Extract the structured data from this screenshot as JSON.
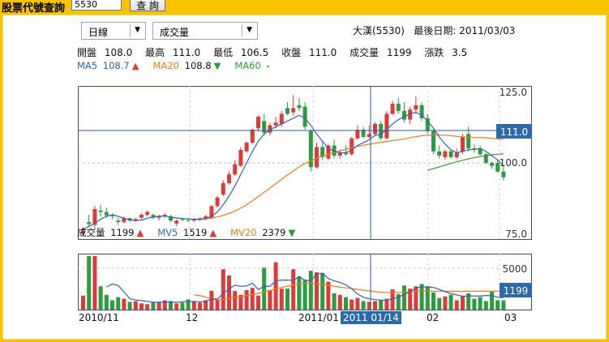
{
  "query": {
    "label": "股票代號查詢",
    "input_value": "5530",
    "button_label": "查 詢"
  },
  "selectors": {
    "period": "日線",
    "indicator": "成交量"
  },
  "stock": {
    "name_code": "大漢(5530)",
    "last_date_label": "最後日期:",
    "last_date": "2011/03/03"
  },
  "ohlc": {
    "open_label": "開盤",
    "open": "108.0",
    "high_label": "最高",
    "high": "111.0",
    "low_label": "最低",
    "low": "106.5",
    "close_label": "收盤",
    "close": "111.0",
    "volume_label": "成交量",
    "volume": "1199",
    "change_label": "漲跌",
    "change": "3.5"
  },
  "ma": {
    "ma5_label": "MA5",
    "ma5_value": "108.7",
    "ma5_arrow": "▲",
    "ma20_label": "MA20",
    "ma20_value": "108.8",
    "ma20_arrow": "▼",
    "ma60_label": "MA60",
    "ma60_value": "-"
  },
  "volume_info": {
    "label": "成交量",
    "value": "1199",
    "arrow": "▲",
    "mv5_label": "MV5",
    "mv5_value": "1519",
    "mv5_arrow": "▲",
    "mv20_label": "MV20",
    "mv20_value": "2379",
    "mv20_arrow": "▼"
  },
  "price_axis": {
    "top": "125.0",
    "mid": "100.0",
    "bottom": "75.0",
    "cursor": "111.0"
  },
  "volume_axis": {
    "top": "5000",
    "cursor": "1199"
  },
  "xaxis": {
    "labels": [
      "2010/11",
      "12",
      "2011/01",
      "02",
      "03"
    ],
    "cursor_date": "2011 01/14"
  },
  "colors": {
    "up": "#dd3b3b",
    "down": "#2f9a3f",
    "ma5": "#2d63b8",
    "ma20": "#f07a1c",
    "ma60": "#3a9a3a",
    "cursor_badge": "#2d6aa9",
    "page_bg": "#f8c400"
  },
  "chart_data": [
    {
      "type": "candlestick",
      "title": "",
      "y_range": [
        75,
        125
      ],
      "candles": [
        {
          "o": 75.5,
          "h": 77.5,
          "l": 74.8,
          "c": 76.5
        },
        {
          "o": 79.5,
          "h": 82.0,
          "l": 78.0,
          "c": 78.8
        },
        {
          "o": 78.5,
          "h": 85.0,
          "l": 77.0,
          "c": 84.0
        },
        {
          "o": 83.5,
          "h": 85.5,
          "l": 81.5,
          "c": 83.0
        },
        {
          "o": 83.0,
          "h": 84.5,
          "l": 81.0,
          "c": 81.8
        },
        {
          "o": 81.8,
          "h": 82.5,
          "l": 80.5,
          "c": 81.5
        },
        {
          "o": 80.0,
          "h": 81.0,
          "l": 78.5,
          "c": 79.5
        },
        {
          "o": 79.5,
          "h": 81.5,
          "l": 79.0,
          "c": 80.8
        },
        {
          "o": 80.8,
          "h": 81.0,
          "l": 79.5,
          "c": 80.0
        },
        {
          "o": 80.0,
          "h": 81.0,
          "l": 79.5,
          "c": 80.5
        },
        {
          "o": 81.0,
          "h": 82.5,
          "l": 80.5,
          "c": 82.0
        },
        {
          "o": 82.0,
          "h": 83.5,
          "l": 81.5,
          "c": 83.0
        },
        {
          "o": 82.0,
          "h": 82.5,
          "l": 80.5,
          "c": 81.0
        },
        {
          "o": 81.0,
          "h": 82.0,
          "l": 80.0,
          "c": 81.5
        },
        {
          "o": 81.5,
          "h": 82.5,
          "l": 80.8,
          "c": 82.0
        },
        {
          "o": 81.5,
          "h": 82.0,
          "l": 79.5,
          "c": 80.0
        },
        {
          "o": 79.0,
          "h": 80.5,
          "l": 78.0,
          "c": 80.0
        },
        {
          "o": 80.5,
          "h": 81.0,
          "l": 79.8,
          "c": 80.2
        },
        {
          "o": 80.2,
          "h": 80.8,
          "l": 79.5,
          "c": 80.0
        },
        {
          "o": 80.0,
          "h": 81.0,
          "l": 79.5,
          "c": 80.5
        },
        {
          "o": 80.3,
          "h": 81.2,
          "l": 79.8,
          "c": 80.8
        },
        {
          "o": 80.8,
          "h": 82.0,
          "l": 80.0,
          "c": 81.5
        },
        {
          "o": 81.0,
          "h": 85.5,
          "l": 80.5,
          "c": 85.0
        },
        {
          "o": 85.0,
          "h": 88.5,
          "l": 84.5,
          "c": 88.0
        },
        {
          "o": 89.0,
          "h": 94.0,
          "l": 88.5,
          "c": 93.0
        },
        {
          "o": 93.0,
          "h": 97.0,
          "l": 92.5,
          "c": 96.0
        },
        {
          "o": 96.0,
          "h": 101.0,
          "l": 95.5,
          "c": 99.5
        },
        {
          "o": 99.0,
          "h": 105.5,
          "l": 98.5,
          "c": 104.5
        },
        {
          "o": 104.0,
          "h": 107.5,
          "l": 103.5,
          "c": 107.0
        },
        {
          "o": 107.0,
          "h": 112.0,
          "l": 106.5,
          "c": 111.5
        },
        {
          "o": 112.0,
          "h": 116.5,
          "l": 111.0,
          "c": 116.0
        },
        {
          "o": 114.5,
          "h": 117.0,
          "l": 109.5,
          "c": 110.5
        },
        {
          "o": 110.5,
          "h": 114.0,
          "l": 109.5,
          "c": 113.0
        },
        {
          "o": 113.0,
          "h": 116.0,
          "l": 112.0,
          "c": 114.0
        },
        {
          "o": 113.5,
          "h": 118.0,
          "l": 112.5,
          "c": 117.0
        },
        {
          "o": 119.0,
          "h": 121.0,
          "l": 116.5,
          "c": 117.0
        },
        {
          "o": 117.5,
          "h": 123.5,
          "l": 116.5,
          "c": 119.0
        },
        {
          "o": 120.0,
          "h": 122.5,
          "l": 118.0,
          "c": 119.0
        },
        {
          "o": 119.5,
          "h": 121.0,
          "l": 111.5,
          "c": 112.5
        },
        {
          "o": 111.0,
          "h": 111.5,
          "l": 97.0,
          "c": 98.5
        },
        {
          "o": 98.5,
          "h": 107.0,
          "l": 98.0,
          "c": 105.5
        },
        {
          "o": 105.5,
          "h": 107.5,
          "l": 101.0,
          "c": 102.0
        },
        {
          "o": 101.5,
          "h": 106.5,
          "l": 101.0,
          "c": 106.0
        },
        {
          "o": 106.0,
          "h": 108.0,
          "l": 101.5,
          "c": 102.5
        },
        {
          "o": 102.5,
          "h": 104.5,
          "l": 101.5,
          "c": 103.5
        },
        {
          "o": 103.5,
          "h": 106.0,
          "l": 102.5,
          "c": 103.0
        },
        {
          "o": 103.0,
          "h": 109.0,
          "l": 102.5,
          "c": 108.5
        },
        {
          "o": 108.5,
          "h": 113.0,
          "l": 108.0,
          "c": 111.5
        },
        {
          "o": 111.5,
          "h": 112.5,
          "l": 108.5,
          "c": 109.0
        },
        {
          "o": 109.0,
          "h": 113.0,
          "l": 108.5,
          "c": 110.0
        },
        {
          "o": 110.0,
          "h": 114.0,
          "l": 109.5,
          "c": 113.5
        },
        {
          "o": 113.5,
          "h": 114.5,
          "l": 108.0,
          "c": 108.5
        },
        {
          "o": 108.5,
          "h": 118.0,
          "l": 108.0,
          "c": 117.0
        },
        {
          "o": 117.0,
          "h": 121.5,
          "l": 116.5,
          "c": 120.5
        },
        {
          "o": 120.5,
          "h": 122.5,
          "l": 117.0,
          "c": 118.0
        },
        {
          "o": 118.0,
          "h": 121.0,
          "l": 114.0,
          "c": 115.0
        },
        {
          "o": 115.0,
          "h": 119.5,
          "l": 113.5,
          "c": 118.5
        },
        {
          "o": 118.5,
          "h": 123.0,
          "l": 117.0,
          "c": 120.0
        },
        {
          "o": 120.0,
          "h": 121.0,
          "l": 114.5,
          "c": 115.5
        },
        {
          "o": 115.5,
          "h": 117.0,
          "l": 110.0,
          "c": 111.0
        },
        {
          "o": 111.0,
          "h": 111.5,
          "l": 103.0,
          "c": 104.0
        },
        {
          "o": 104.0,
          "h": 106.0,
          "l": 101.5,
          "c": 102.5
        },
        {
          "o": 102.0,
          "h": 104.5,
          "l": 101.0,
          "c": 104.0
        },
        {
          "o": 104.0,
          "h": 104.5,
          "l": 101.5,
          "c": 102.0
        },
        {
          "o": 102.0,
          "h": 105.0,
          "l": 101.5,
          "c": 103.5
        },
        {
          "o": 104.0,
          "h": 110.0,
          "l": 103.0,
          "c": 109.0
        },
        {
          "o": 110.0,
          "h": 112.5,
          "l": 104.0,
          "c": 105.0
        },
        {
          "o": 105.0,
          "h": 106.5,
          "l": 103.5,
          "c": 104.5
        },
        {
          "o": 105.0,
          "h": 106.0,
          "l": 102.5,
          "c": 103.0
        },
        {
          "o": 103.0,
          "h": 103.5,
          "l": 99.5,
          "c": 100.0
        },
        {
          "o": 100.0,
          "h": 100.5,
          "l": 98.0,
          "c": 99.0
        },
        {
          "o": 100.0,
          "h": 101.0,
          "l": 96.5,
          "c": 97.0
        },
        {
          "o": 97.0,
          "h": 99.0,
          "l": 94.0,
          "c": 95.0
        }
      ],
      "ma5": [
        77,
        78,
        79,
        80.5,
        81.5,
        82,
        81.5,
        80.8,
        80.3,
        80,
        80.2,
        80.8,
        81.3,
        81.5,
        81.6,
        81.2,
        80.9,
        80.7,
        80.6,
        80.4,
        80.4,
        80.6,
        81.5,
        83,
        85.5,
        88.5,
        92,
        96,
        100,
        104,
        107.5,
        110,
        111.5,
        112.5,
        113.5,
        114.5,
        115.5,
        116.5,
        115.5,
        113,
        110,
        107.5,
        105,
        104,
        103.5,
        103.5,
        104.5,
        106,
        107,
        108,
        109.5,
        110,
        111.5,
        113.5,
        115,
        116,
        117,
        117.5,
        116.5,
        114.5,
        112,
        109,
        106.5,
        104.5,
        103.5,
        104,
        104.5,
        104.8,
        105,
        104,
        102.5,
        101,
        99
      ],
      "ma20": [
        null,
        null,
        null,
        null,
        null,
        null,
        null,
        null,
        null,
        null,
        null,
        null,
        null,
        null,
        null,
        null,
        null,
        null,
        null,
        80.5,
        80.6,
        80.7,
        80.9,
        81.3,
        81.8,
        82.5,
        83.3,
        84.3,
        85.5,
        86.8,
        88.3,
        89.8,
        91.3,
        92.8,
        94.3,
        95.8,
        97.2,
        98.6,
        99.8,
        100.8,
        101.6,
        102.3,
        103,
        103.6,
        104.2,
        104.7,
        105.2,
        105.7,
        106.1,
        106.5,
        106.8,
        107.1,
        107.4,
        107.7,
        108,
        108.3,
        108.7,
        109.1,
        109.4,
        109.6,
        109.7,
        109.7,
        109.6,
        109.4,
        109.2,
        109,
        108.9,
        108.8,
        108.8,
        108.7,
        108.5,
        108.3,
        108.1
      ],
      "ma60": [
        null,
        null,
        null,
        null,
        null,
        null,
        null,
        null,
        null,
        null,
        null,
        null,
        null,
        null,
        null,
        null,
        null,
        null,
        null,
        null,
        null,
        null,
        null,
        null,
        null,
        null,
        null,
        null,
        null,
        null,
        null,
        null,
        null,
        null,
        null,
        null,
        null,
        null,
        null,
        null,
        null,
        null,
        null,
        null,
        null,
        null,
        null,
        null,
        null,
        null,
        null,
        null,
        null,
        null,
        null,
        null,
        null,
        null,
        null,
        97.5,
        98,
        98.6,
        99.2,
        99.8,
        100.4,
        100.9,
        101.4,
        101.8,
        102.2,
        102.5,
        102.8,
        103.0,
        103.2
      ]
    },
    {
      "type": "bar",
      "title": "",
      "y_range": [
        0,
        7000
      ],
      "volumes": [
        1800,
        6900,
        6900,
        3000,
        1900,
        1200,
        1600,
        1400,
        1000,
        1100,
        800,
        700,
        900,
        1000,
        1200,
        1100,
        800,
        900,
        1300,
        1000,
        900,
        1200,
        2400,
        1300,
        5200,
        4400,
        2400,
        1900,
        2500,
        2800,
        1800,
        5400,
        2500,
        6100,
        2700,
        2700,
        5200,
        4300,
        3800,
        5000,
        4800,
        4700,
        3600,
        2100,
        1900,
        1600,
        1300,
        1500,
        1100,
        1000,
        1100,
        1200,
        1400,
        2600,
        2000,
        3100,
        2700,
        3000,
        3300,
        2900,
        2200,
        1500,
        1700,
        1900,
        1200,
        1800,
        2100,
        1400,
        1600,
        1100,
        2300,
        1200,
        1199
      ],
      "mv5": [
        null,
        null,
        null,
        null,
        2900,
        3300,
        3100,
        2300,
        1400,
        1250,
        1150,
        1050,
        950,
        950,
        950,
        950,
        950,
        1000,
        1050,
        1050,
        1000,
        1050,
        1400,
        1350,
        2100,
        2650,
        3150,
        3000,
        3050,
        3400,
        2600,
        3000,
        3000,
        3700,
        3800,
        3800,
        3800,
        4200,
        3800,
        3700,
        4600,
        4700,
        4000,
        3700,
        3500,
        3200,
        2700,
        2000,
        1600,
        1400,
        1300,
        1200,
        1200,
        1400,
        1600,
        1950,
        2300,
        2800,
        2900,
        2950,
        2850,
        2600,
        2300,
        2050,
        1900,
        1700,
        1750,
        1750,
        1750,
        1800,
        1800,
        1600,
        1519
      ],
      "mv20": [
        null,
        null,
        null,
        null,
        null,
        null,
        null,
        null,
        null,
        null,
        null,
        null,
        null,
        null,
        null,
        null,
        null,
        null,
        null,
        1900,
        1800,
        1600,
        1400,
        1200,
        1300,
        1450,
        1550,
        1650,
        1800,
        1950,
        2100,
        2300,
        2450,
        2700,
        2850,
        3000,
        3150,
        3300,
        3400,
        3450,
        3350,
        3250,
        3150,
        3000,
        2900,
        2800,
        2700,
        2600,
        2500,
        2400,
        2300,
        2250,
        2200,
        2200,
        2200,
        2250,
        2300,
        2350,
        2400,
        2400,
        2350,
        2350,
        2350,
        2350,
        2350,
        2350,
        2360,
        2370,
        2375,
        2378,
        2380,
        2380,
        2379
      ]
    }
  ]
}
